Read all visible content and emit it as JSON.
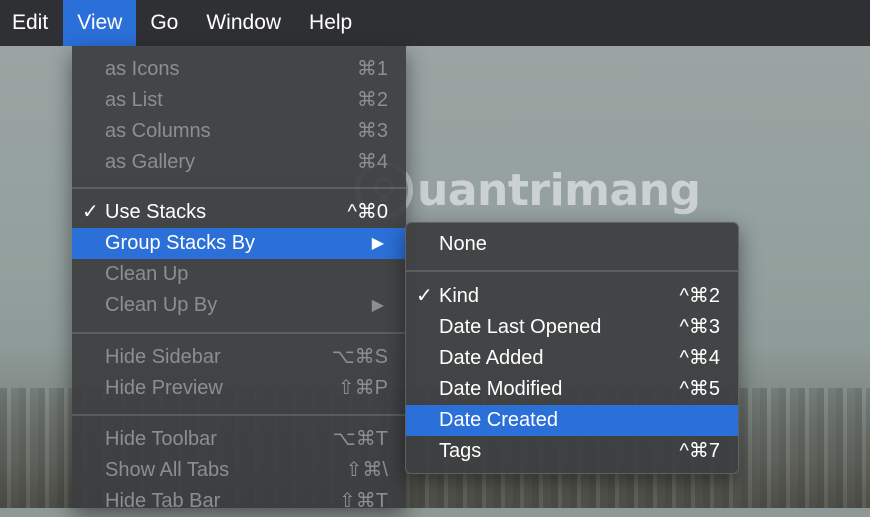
{
  "menubar": {
    "items": [
      "Edit",
      "View",
      "Go",
      "Window",
      "Help"
    ],
    "active": "View"
  },
  "view_menu": {
    "items": [
      {
        "label": "as Icons",
        "shortcut": "⌘1",
        "enabled": false
      },
      {
        "label": "as List",
        "shortcut": "⌘2",
        "enabled": false
      },
      {
        "label": "as Columns",
        "shortcut": "⌘3",
        "enabled": false
      },
      {
        "label": "as Gallery",
        "shortcut": "⌘4",
        "enabled": false
      },
      {
        "label": "Use Stacks",
        "shortcut": "^⌘0",
        "enabled": true,
        "checked": true
      },
      {
        "label": "Group Stacks By",
        "enabled": true,
        "submenu_arrow": "▶"
      },
      {
        "label": "Clean Up",
        "enabled": false
      },
      {
        "label": "Clean Up By",
        "enabled": false,
        "submenu_arrow": "▶"
      },
      {
        "label": "Hide Sidebar",
        "shortcut": "⌥⌘S",
        "enabled": false
      },
      {
        "label": "Hide Preview",
        "shortcut": "⇧⌘P",
        "enabled": false
      },
      {
        "label": "Hide Toolbar",
        "shortcut": "⌥⌘T",
        "enabled": false
      },
      {
        "label": "Show All Tabs",
        "shortcut": "⇧⌘\\",
        "enabled": false
      },
      {
        "label": "Hide Tab Bar",
        "shortcut": "⇧⌘T",
        "enabled": false
      }
    ]
  },
  "group_submenu": {
    "items": [
      {
        "label": "None"
      },
      {
        "label": "Kind",
        "shortcut": "^⌘2",
        "checked": true
      },
      {
        "label": "Date Last Opened",
        "shortcut": "^⌘3"
      },
      {
        "label": "Date Added",
        "shortcut": "^⌘4"
      },
      {
        "label": "Date Modified",
        "shortcut": "^⌘5"
      },
      {
        "label": "Date Created",
        "highlighted": true
      },
      {
        "label": "Tags",
        "shortcut": "^⌘7"
      }
    ]
  },
  "checkmark": "✓",
  "watermark": {
    "text": "uantrimang"
  },
  "colors": {
    "menubar_bg": "#2f3033",
    "highlight": "#2b6fd8",
    "menu_bg": "#3c3d40",
    "disabled_text": "#8d8e90"
  }
}
